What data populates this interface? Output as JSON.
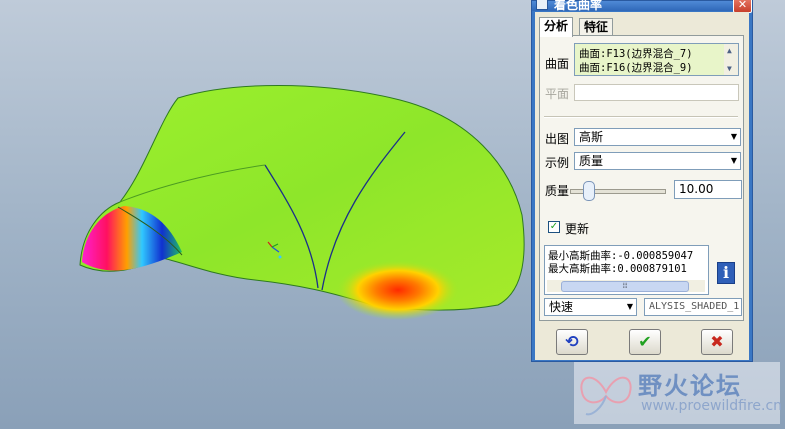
{
  "window": {
    "title": "着色曲率",
    "close_glyph": "✕"
  },
  "tabs": [
    {
      "label": "分析"
    },
    {
      "label": "特征"
    }
  ],
  "surface": {
    "label": "曲面",
    "items": [
      "曲面:F13(边界混合_7)",
      "曲面:F16(边界混合_9)"
    ]
  },
  "plane": {
    "label": "平面",
    "value": ""
  },
  "output": {
    "label": "出图",
    "value": "高斯"
  },
  "example": {
    "label": "示例",
    "value": "质量"
  },
  "quality": {
    "label": "质量",
    "value": "10.00",
    "slider_fraction": 0.15
  },
  "update": {
    "label": "更新",
    "checked": true
  },
  "results": {
    "min_label": "最小高斯曲率:",
    "min_value": "-0.000859047",
    "max_label": "最大高斯曲率:",
    "max_value": "0.000879101"
  },
  "mode": {
    "value": "快速"
  },
  "analysis_name": {
    "value": "ALYSIS_SHADED_1"
  },
  "buttons": {
    "repeat": "⟲",
    "ok": "✔",
    "cancel": "✖"
  },
  "watermark": {
    "title": "野火论坛",
    "url": "www.proewildfire.cn"
  },
  "colors": {
    "accent": "#3a77c4",
    "ok": "#21a121",
    "cancel": "#c8281e",
    "surface_base": "#8ee62a"
  }
}
